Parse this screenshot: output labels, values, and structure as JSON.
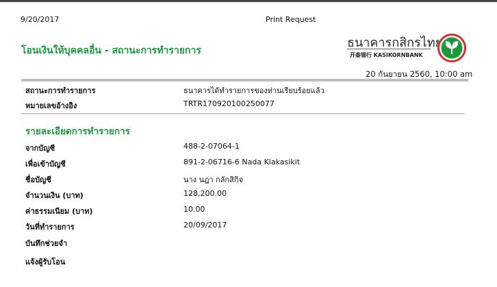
{
  "header": {
    "print_date": "9/20/2017",
    "print_title": "Print Request"
  },
  "page_title": "โอนเงินให้บุคคลอื่น - สถานะการทำรายการ",
  "bank": {
    "name_th": "ธนาคารกสิกรไทย",
    "name_en": "开泰银行 KASIKORNBANK",
    "brand_color": "#1a9a3a",
    "accent_color": "#d32f2f"
  },
  "timestamp": "20 กันยายน 2560, 10:00 am",
  "status_block": [
    {
      "label": "สถานะการทำรายการ",
      "value": "ธนาคารได้ทำรายการของท่านเรียบร้อยแล้ว"
    },
    {
      "label": "หมายเลขอ้างอิง",
      "value": "TRTR170920100250077"
    }
  ],
  "details_title": "รายละเอียดการทำรายการ",
  "details": [
    {
      "label": "จากบัญชี",
      "value": "488-2-07064-1"
    },
    {
      "label": "เพื่อเข้าบัญชี",
      "value": "891-2-06716-6 Nada Klakasikit"
    },
    {
      "label": "ชื่อบัญชี",
      "value": "นาง นฎา กลักสิกิจ"
    },
    {
      "label": "จำนวนเงิน (บาท)",
      "value": "128,200.00"
    },
    {
      "label": "ค่าธรรมเนียม (บาท)",
      "value": "10.00"
    },
    {
      "label": "วันที่ทำรายการ",
      "value": "20/09/2017"
    },
    {
      "label": "บันทึกช่วยจำ",
      "value": ""
    },
    {
      "label": "แจ้งผู้รับโอน",
      "value": ""
    }
  ]
}
